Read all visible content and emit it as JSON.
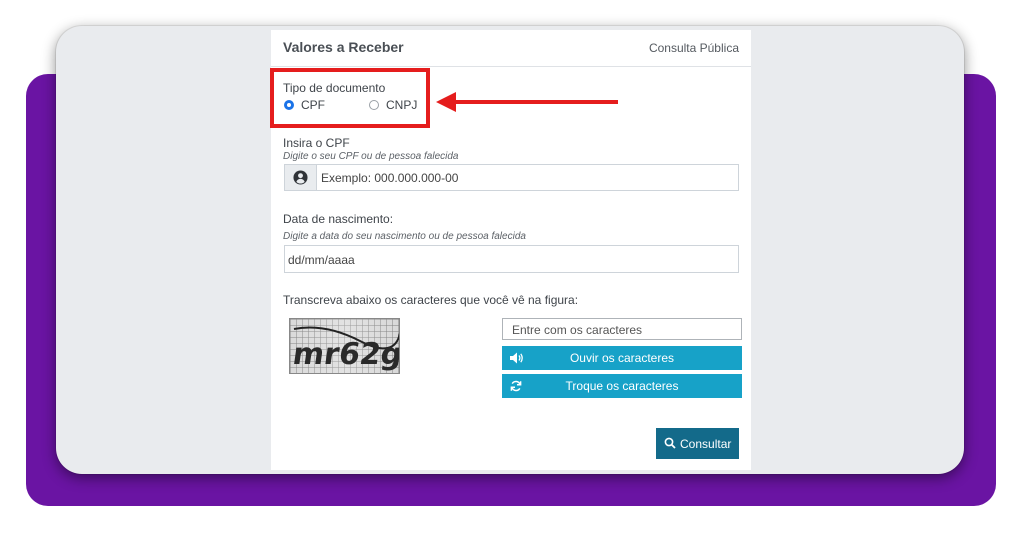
{
  "page": {
    "title": "Valores a Receber",
    "subtitle": "Consulta Pública"
  },
  "document_type": {
    "label": "Tipo de documento",
    "options": [
      {
        "label": "CPF",
        "selected": true
      },
      {
        "label": "CNPJ",
        "selected": false
      }
    ]
  },
  "cpf": {
    "label": "Insira o CPF",
    "hint": "Digite o seu CPF ou de pessoa falecida",
    "placeholder": "Exemplo: 000.000.000-00",
    "icon": "user-circle-icon"
  },
  "birth": {
    "label": "Data de nascimento:",
    "hint": "Digite a data do seu nascimento ou de pessoa falecida",
    "placeholder": "dd/mm/aaaa"
  },
  "captcha": {
    "instruction": "Transcreva abaixo os caracteres que você vê na figura:",
    "image_text": "mr62g",
    "input_placeholder": "Entre com os caracteres",
    "listen_label": "Ouvir os caracteres",
    "refresh_label": "Troque os caracteres"
  },
  "submit": {
    "label": "Consultar"
  },
  "colors": {
    "annotation_red": "#e51d1d",
    "brand_purple": "#6a14a3",
    "button_teal": "#17a2c8",
    "button_dark": "#136a8a",
    "radio_blue": "#1a73e8"
  }
}
